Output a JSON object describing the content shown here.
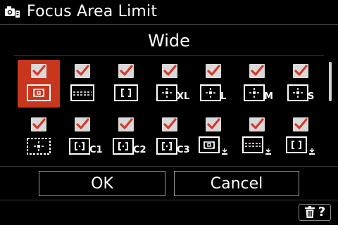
{
  "header": {
    "title": "Focus Area Limit",
    "icon": "camera-settings-icon"
  },
  "subtitle": "Wide",
  "grid": {
    "items": [
      {
        "icon": "focus-wide-icon",
        "checked": true,
        "selected": true,
        "suffix": ""
      },
      {
        "icon": "focus-zone-icon",
        "checked": true,
        "selected": false,
        "suffix": ""
      },
      {
        "icon": "focus-center-icon",
        "checked": true,
        "selected": false,
        "suffix": ""
      },
      {
        "icon": "focus-flexible-spot-icon",
        "checked": true,
        "selected": false,
        "suffix": "XL"
      },
      {
        "icon": "focus-flexible-spot-icon",
        "checked": true,
        "selected": false,
        "suffix": "L"
      },
      {
        "icon": "focus-flexible-spot-icon",
        "checked": true,
        "selected": false,
        "suffix": "M"
      },
      {
        "icon": "focus-flexible-spot-icon",
        "checked": true,
        "selected": false,
        "suffix": "S"
      },
      {
        "icon": "focus-expand-spot-icon",
        "checked": true,
        "selected": false,
        "suffix": ""
      },
      {
        "icon": "focus-fixed-center-icon",
        "checked": true,
        "selected": false,
        "suffix": "C1"
      },
      {
        "icon": "focus-fixed-center-icon",
        "checked": true,
        "selected": false,
        "suffix": "C2"
      },
      {
        "icon": "focus-fixed-center-icon",
        "checked": true,
        "selected": false,
        "suffix": "C3"
      },
      {
        "icon": "tracking-wide-icon",
        "checked": true,
        "selected": false,
        "suffix": ""
      },
      {
        "icon": "tracking-zone-icon",
        "checked": true,
        "selected": false,
        "suffix": ""
      },
      {
        "icon": "tracking-center-icon",
        "checked": true,
        "selected": false,
        "suffix": ""
      }
    ]
  },
  "buttons": {
    "ok": "OK",
    "cancel": "Cancel"
  },
  "footer": {
    "help_label": "?",
    "icon": "trash-icon"
  },
  "colors": {
    "accent": "#c8361d",
    "check": "#d33a2a",
    "box": "#d9d9d9"
  }
}
